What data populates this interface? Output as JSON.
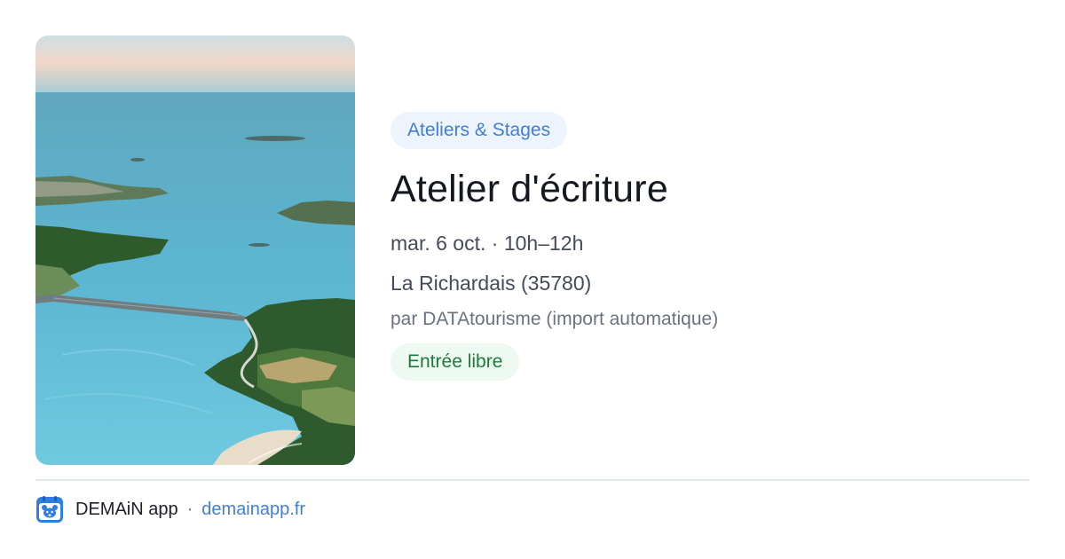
{
  "event": {
    "image": {
      "subject": "aerial-coast-photo"
    },
    "category": "Ateliers & Stages",
    "title": "Atelier d'écriture",
    "datetime": "mar. 6 oct. · 10h–12h",
    "location": "La Richardais (35780)",
    "source": "par DATAtourisme (import automatique)",
    "price": "Entrée libre"
  },
  "footer": {
    "logo_icon": "bear-calendar-icon",
    "app_name": "DEMAiN app",
    "separator": "·",
    "site": "demainapp.fr"
  },
  "colors": {
    "accent": "#3f7fd6",
    "category_bg": "#eef4fd",
    "price_bg": "#eefaf1",
    "price_text": "#1f7a3c",
    "title": "#14181f"
  }
}
